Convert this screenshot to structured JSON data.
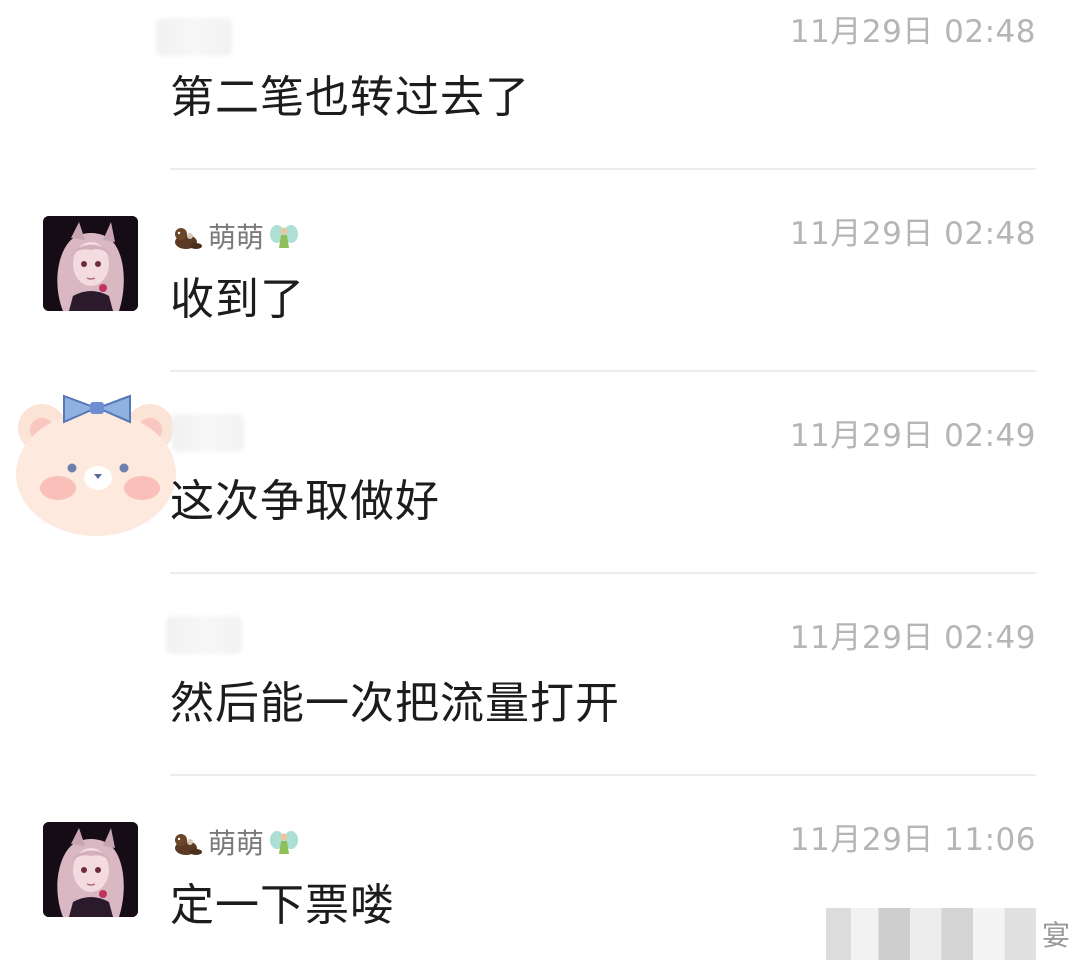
{
  "messages": [
    {
      "sender": "",
      "time": "11月29日 02:48",
      "text": "第二笔也转过去了"
    },
    {
      "sender": "萌萌",
      "time": "11月29日 02:48",
      "text": "收到了"
    },
    {
      "sender": "",
      "time": "11月29日 02:49",
      "text": "这次争取做好"
    },
    {
      "sender": "",
      "time": "11月29日 02:49",
      "text": "然后能一次把流量打开"
    },
    {
      "sender": "萌萌",
      "time": "11月29日 11:06",
      "text": "定一下票喽"
    }
  ],
  "watermark": {
    "text": "宴"
  },
  "icons": {
    "sender_prefix": "otter-icon",
    "sender_suffix": "fairy-icon"
  }
}
